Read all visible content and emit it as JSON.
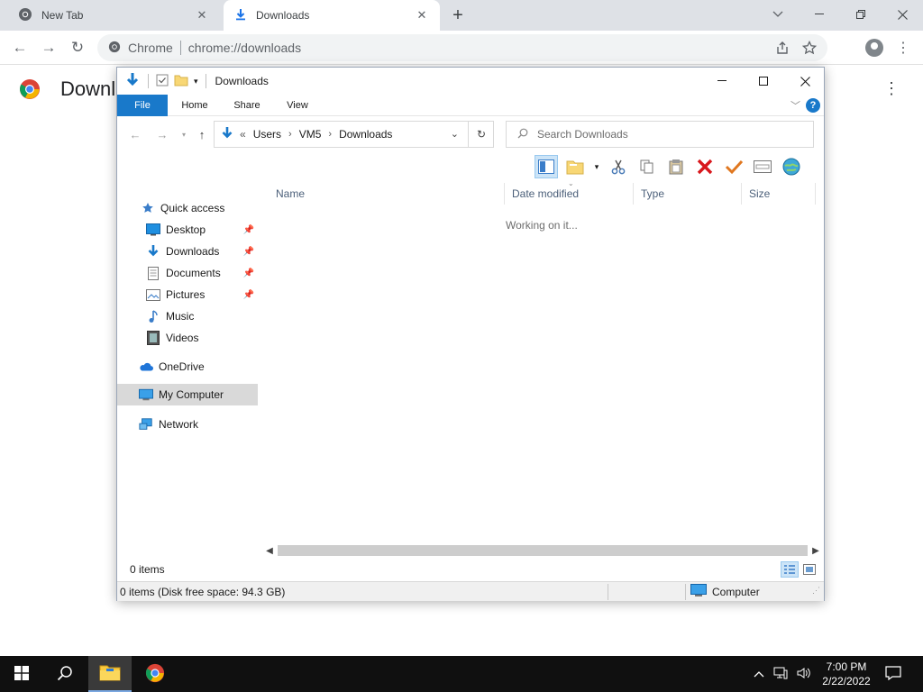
{
  "browser": {
    "tabs": [
      {
        "title": "New Tab",
        "active": false
      },
      {
        "title": "Downloads",
        "active": true
      }
    ],
    "omnibox": {
      "site_chip": "Chrome",
      "url": "chrome://downloads"
    },
    "page_title": "Downl"
  },
  "explorer": {
    "title": "Downloads",
    "ribbon_tabs": [
      "File",
      "Home",
      "Share",
      "View"
    ],
    "breadcrumb": {
      "overflow": "«",
      "parts": [
        "Users",
        "VM5",
        "Downloads"
      ]
    },
    "search_placeholder": "Search Downloads",
    "nav": {
      "quick_access": "Quick access",
      "items": [
        {
          "label": "Desktop",
          "icon": "desktop-icon",
          "pinned": true
        },
        {
          "label": "Downloads",
          "icon": "downloads-icon",
          "pinned": true
        },
        {
          "label": "Documents",
          "icon": "documents-icon",
          "pinned": true
        },
        {
          "label": "Pictures",
          "icon": "pictures-icon",
          "pinned": true
        },
        {
          "label": "Music",
          "icon": "music-icon",
          "pinned": false
        },
        {
          "label": "Videos",
          "icon": "videos-icon",
          "pinned": false
        }
      ],
      "onedrive": "OneDrive",
      "my_computer": "My Computer",
      "network": "Network"
    },
    "columns": [
      "Name",
      "Date modified",
      "Type",
      "Size"
    ],
    "working_text": "Working on it...",
    "item_count": "0 items",
    "status_detail": "0 items (Disk free space: 94.3 GB)",
    "status_location": "Computer",
    "accent_color": "#1979ca"
  },
  "taskbar": {
    "time": "7:00 PM",
    "date": "2/22/2022"
  }
}
